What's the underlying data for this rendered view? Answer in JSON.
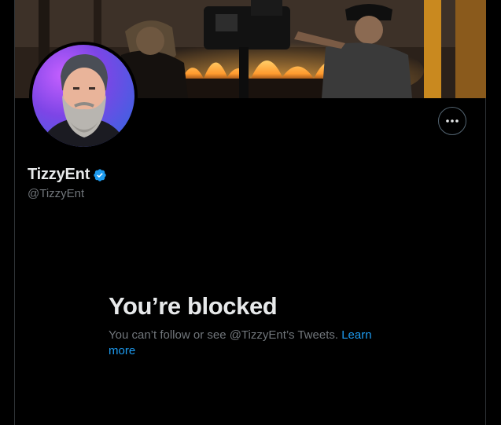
{
  "profile": {
    "display_name": "TizzyEnt",
    "handle": "@TizzyEnt",
    "verified": true
  },
  "blocked_notice": {
    "title": "You’re blocked",
    "message": "You can’t follow or see @TizzyEnt’s Tweets.",
    "link_label": "Learn more"
  },
  "icons": {
    "more": "more-options-icon",
    "verified": "verified-badge-icon"
  },
  "colors": {
    "background": "#000000",
    "primary_text": "#e7e9ea",
    "secondary_text": "#71767b",
    "link": "#1d9bf0",
    "border": "#2f3336",
    "verified_badge": "#1d9bf0"
  }
}
